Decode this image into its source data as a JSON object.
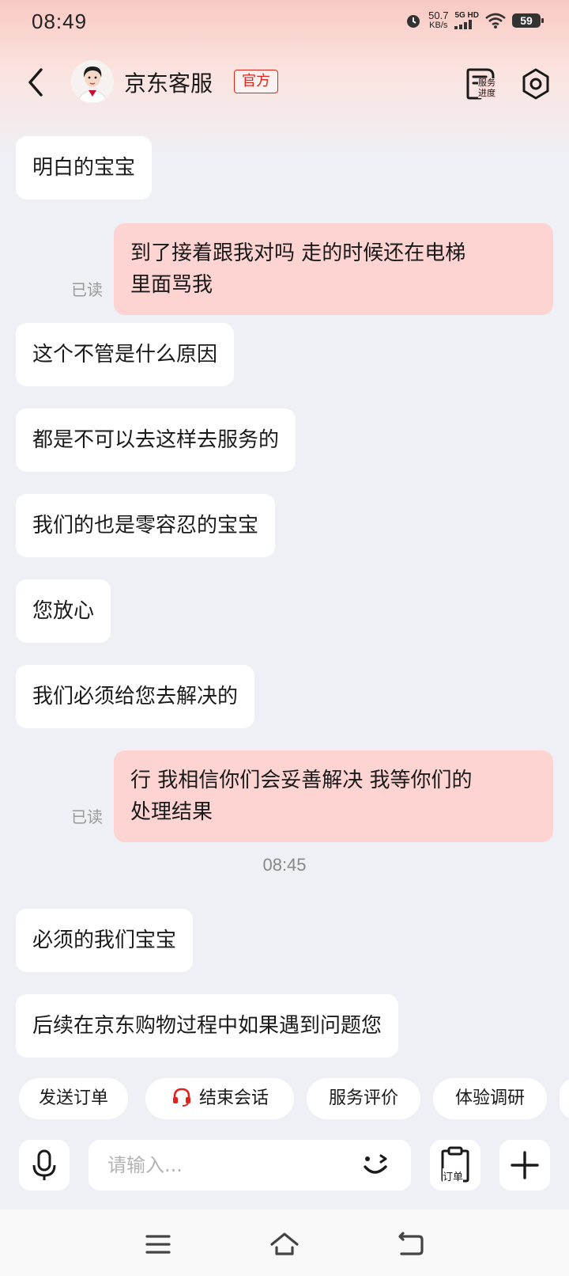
{
  "status_bar": {
    "time": "08:49",
    "net_speed_value": "50.7",
    "net_speed_unit": "KB/s",
    "net_type": "5G HD",
    "battery": "59"
  },
  "header": {
    "title": "京东客服",
    "badge": "官方",
    "service_progress_label_1": "服务",
    "service_progress_label_2": "进度"
  },
  "messages": [
    {
      "side": "left",
      "text": "明白的宝宝"
    },
    {
      "side": "right",
      "line1": "到了接着跟我对吗 走的时候还在电梯",
      "line2": "里面骂我",
      "status": "已读"
    },
    {
      "side": "left",
      "text": "这个不管是什么原因"
    },
    {
      "side": "left",
      "text": "都是不可以去这样去服务的"
    },
    {
      "side": "left",
      "text": "我们的也是零容忍的宝宝"
    },
    {
      "side": "left",
      "text": "您放心"
    },
    {
      "side": "left",
      "text": "我们必须给您去解决的"
    },
    {
      "side": "right",
      "line1": "行 我相信你们会妥善解决 我等你们的",
      "line2": "处理结果",
      "status": "已读"
    },
    {
      "side": "time",
      "text": "08:45"
    },
    {
      "side": "left",
      "text": "必须的我们宝宝"
    },
    {
      "side": "left",
      "text": "后续在京东购物过程中如果遇到问题您"
    }
  ],
  "quick_actions": [
    {
      "label": "发送订单"
    },
    {
      "label": "结束会话",
      "icon": "headset-icon"
    },
    {
      "label": "服务评价"
    },
    {
      "label": "体验调研"
    }
  ],
  "input": {
    "placeholder": "请输入...",
    "order_label": "订单"
  },
  "colors": {
    "accent": "#e2231a",
    "bubble_right": "#fdd4d1",
    "bubble_left": "#ffffff",
    "background": "#eff0f5"
  }
}
